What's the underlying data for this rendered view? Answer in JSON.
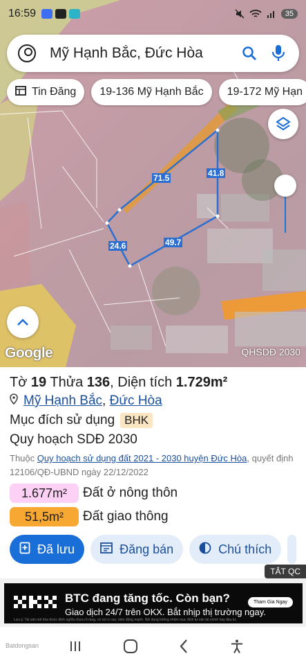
{
  "status_bar": {
    "time": "16:59",
    "battery": "35"
  },
  "search": {
    "query": "Mỹ Hạnh Bắc, Đức Hòa"
  },
  "chips": [
    {
      "label": "Tin Đăng",
      "icon": "listing-icon"
    },
    {
      "label": "19-136 Mỹ Hạnh Bắc"
    },
    {
      "label": "19-172 Mỹ Hạn"
    }
  ],
  "map": {
    "measurements": [
      "71.5",
      "41.8",
      "24.6",
      "49.7"
    ],
    "google_label": "Google",
    "layer_label": "QHSDĐ 2030"
  },
  "parcel": {
    "to_label": "Tờ",
    "to_value": "19",
    "thua_label": "Thửa",
    "thua_value": "136",
    "area_label": "Diện tích",
    "area_value": "1.729m²",
    "commune": "Mỹ Hạnh Bắc",
    "separator": ",",
    "district": "Đức Hòa",
    "purpose_label": "Mục đích sử dụng",
    "purpose_code": "BHK",
    "planning_label": "Quy hoạch SDĐ 2030",
    "source_prefix": "Thuộc",
    "source_link": "Quy hoạch sử dụng đất 2021 - 2030 huyện Đức Hòa",
    "source_suffix": ", quyết định 12106/QĐ-UBND ngày 22/12/2022",
    "land_uses": [
      {
        "area": "1.677m²",
        "label": "Đất ở nông thôn",
        "color": "#fdd0f5"
      },
      {
        "area": "51,5m²",
        "label": "Đất giao thông",
        "color": "#f6a833"
      }
    ]
  },
  "actions": [
    {
      "label": "Đã lưu",
      "icon": "saved-icon"
    },
    {
      "label": "Đăng bán",
      "icon": "post-icon"
    },
    {
      "label": "Chú thích",
      "icon": "legend-icon"
    }
  ],
  "ad": {
    "close_label": "TẮT QC",
    "brand": "OKX",
    "headline": "BTC đang tăng tốc. Còn bạn?",
    "subline": "Giao dịch 24/7 trên OKX. Bắt nhịp thị trường ngay.",
    "cta": "Tham Gia Ngay",
    "fine_print": "Lưu ý: Tài sản mã hóa được định nghĩa chưa rõ ràng, có rủi ro cao, biến động mạnh. Nội dung không nhằm mục đích tư vấn tài chính hay đầu tư."
  },
  "watermark": "Batdongsan"
}
